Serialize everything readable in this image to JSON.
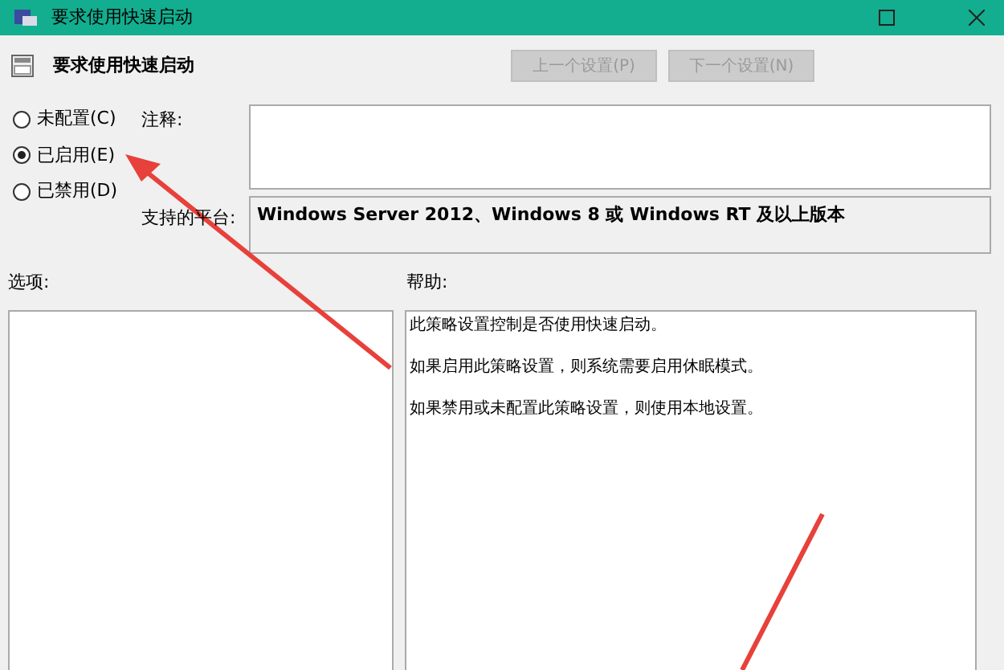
{
  "window": {
    "title": "要求使用快速启动"
  },
  "header": {
    "title": "要求使用快速启动",
    "buttons": [
      {
        "label": "上一个设置(P)",
        "disabled": true
      },
      {
        "label": "下一个设置(N)",
        "disabled": true
      }
    ]
  },
  "options": [
    {
      "label": "未配置(C)",
      "selected": false
    },
    {
      "label": "已启用(E)",
      "selected": true
    },
    {
      "label": "已禁用(D)",
      "selected": false
    }
  ],
  "comment": {
    "label": "注释:"
  },
  "platform": {
    "label": "支持的平台:",
    "value": "Windows Server 2012、Windows 8 或 Windows RT 及以上版本"
  },
  "options_label": "选项:",
  "help": {
    "label": "帮助:",
    "paragraphs": [
      "此策略设置控制是否使用快速启动。",
      "如果启用此策略设置，则系统需要启用休眠模式。",
      "如果禁用或未配置此策略设置，则使用本地设置。"
    ]
  }
}
